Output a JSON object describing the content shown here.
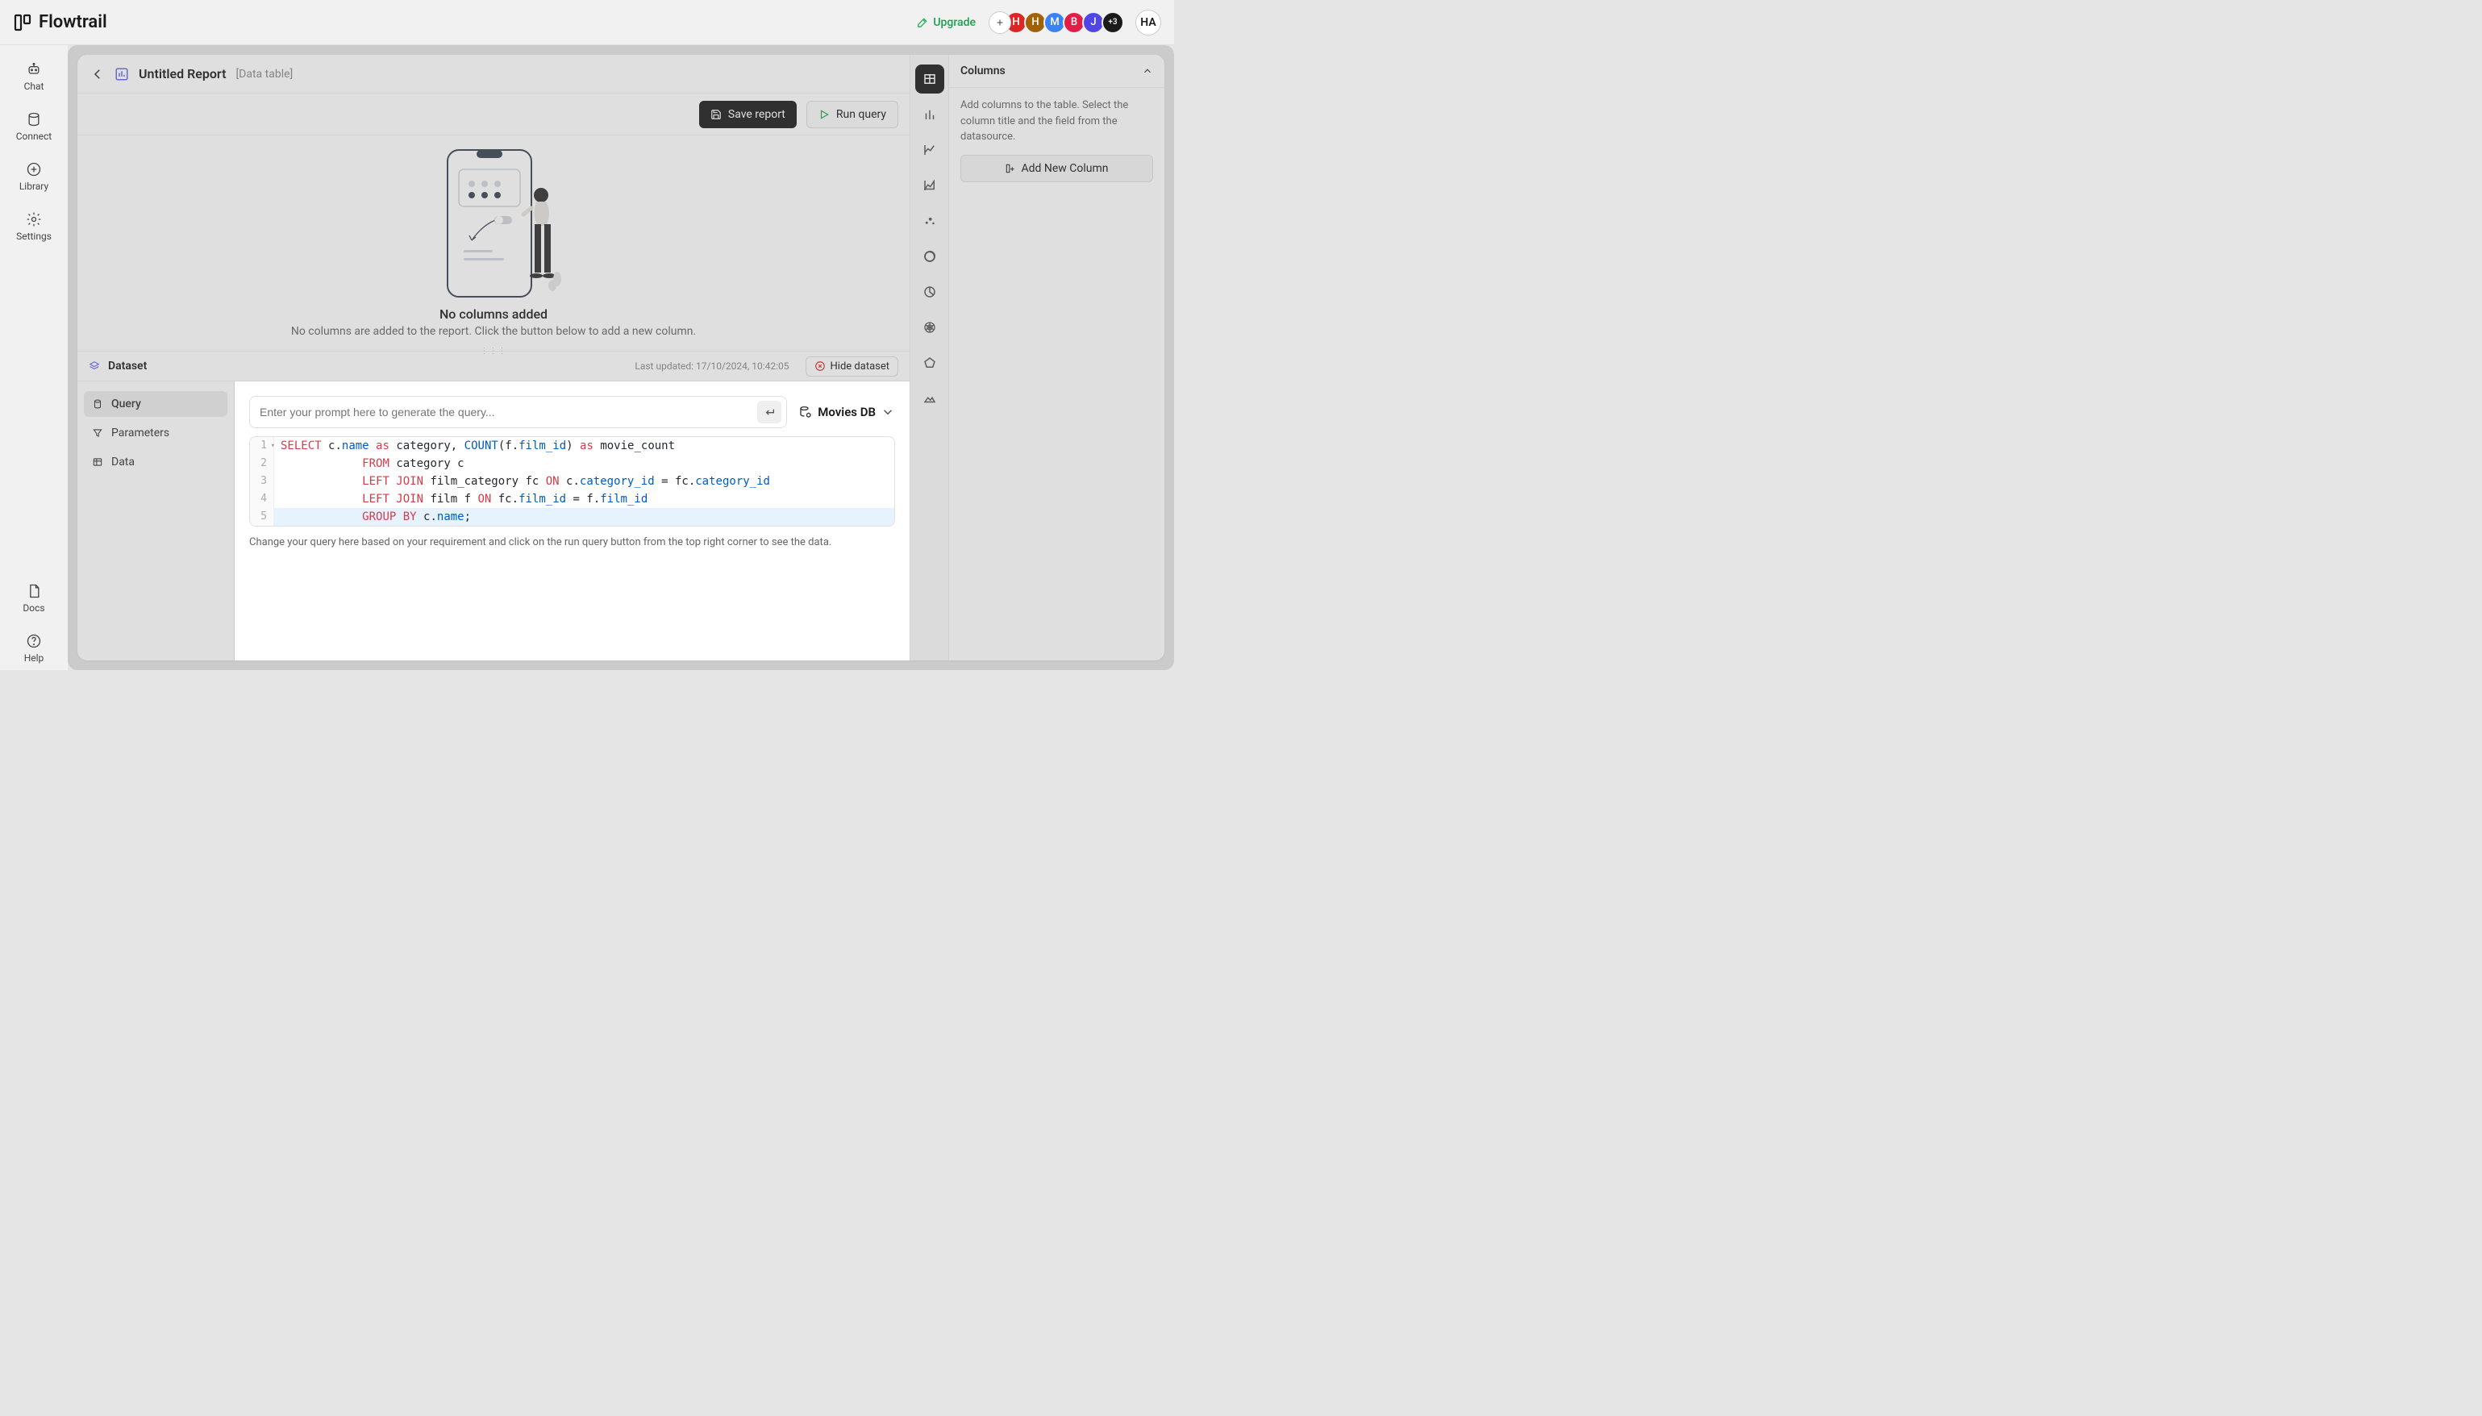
{
  "app": {
    "name": "Flowtrail"
  },
  "topbar": {
    "upgrade": "Upgrade",
    "avatars": [
      {
        "letter": "H",
        "bg": "#dc2626"
      },
      {
        "letter": "H",
        "bg": "#a16207"
      },
      {
        "letter": "M",
        "bg": "#3b82f6"
      },
      {
        "letter": "B",
        "bg": "#e11d48"
      },
      {
        "letter": "J",
        "bg": "#4f46e5"
      }
    ],
    "more_count": "+3",
    "me": "HA"
  },
  "leftnav": {
    "items": [
      {
        "id": "chat",
        "label": "Chat"
      },
      {
        "id": "connect",
        "label": "Connect"
      },
      {
        "id": "library",
        "label": "Library"
      },
      {
        "id": "settings",
        "label": "Settings"
      }
    ],
    "bottom": [
      {
        "id": "docs",
        "label": "Docs"
      },
      {
        "id": "help",
        "label": "Help"
      }
    ]
  },
  "report": {
    "title": "Untitled Report",
    "subtype": "[Data table]",
    "save_label": "Save report",
    "run_label": "Run query"
  },
  "empty": {
    "title": "No columns added",
    "sub": "No columns are added to the report. Click the button below to add a new column."
  },
  "dataset": {
    "title": "Dataset",
    "last_updated_label": "Last updated: 17/10/2024, 10:42:05",
    "hide_label": "Hide dataset",
    "tabs": {
      "query": "Query",
      "parameters": "Parameters",
      "data": "Data"
    }
  },
  "prompt": {
    "placeholder": "Enter your prompt here to generate the query...",
    "db_name": "Movies DB"
  },
  "sql": {
    "lines": [
      {
        "n": "1",
        "tokens": [
          {
            "t": "SELECT",
            "c": "kw-red"
          },
          {
            "t": " "
          },
          {
            "t": "c",
            "c": "plain"
          },
          {
            "t": ".",
            "c": "punct"
          },
          {
            "t": "name",
            "c": "kw-blue"
          },
          {
            "t": " "
          },
          {
            "t": "as",
            "c": "kw-red"
          },
          {
            "t": " "
          },
          {
            "t": "category",
            "c": "plain"
          },
          {
            "t": ",",
            "c": "punct"
          },
          {
            "t": " "
          },
          {
            "t": "COUNT",
            "c": "kw-blue"
          },
          {
            "t": "(",
            "c": "punct"
          },
          {
            "t": "f",
            "c": "plain"
          },
          {
            "t": ".",
            "c": "punct"
          },
          {
            "t": "film_id",
            "c": "kw-blue"
          },
          {
            "t": ")",
            "c": "punct"
          },
          {
            "t": " "
          },
          {
            "t": "as",
            "c": "kw-red"
          },
          {
            "t": " "
          },
          {
            "t": "movie_count",
            "c": "plain"
          }
        ]
      },
      {
        "n": "2",
        "tokens": [
          {
            "t": "            "
          },
          {
            "t": "FROM",
            "c": "kw-red"
          },
          {
            "t": " "
          },
          {
            "t": "category c",
            "c": "plain"
          }
        ]
      },
      {
        "n": "3",
        "tokens": [
          {
            "t": "            "
          },
          {
            "t": "LEFT JOIN",
            "c": "kw-red"
          },
          {
            "t": " "
          },
          {
            "t": "film_category fc ",
            "c": "plain"
          },
          {
            "t": "ON",
            "c": "kw-red"
          },
          {
            "t": " "
          },
          {
            "t": "c",
            "c": "plain"
          },
          {
            "t": ".",
            "c": "punct"
          },
          {
            "t": "category_id",
            "c": "kw-blue"
          },
          {
            "t": " ",
            "c": "plain"
          },
          {
            "t": "=",
            "c": "punct"
          },
          {
            "t": " fc",
            "c": "plain"
          },
          {
            "t": ".",
            "c": "punct"
          },
          {
            "t": "category_id",
            "c": "kw-blue"
          }
        ]
      },
      {
        "n": "4",
        "tokens": [
          {
            "t": "            "
          },
          {
            "t": "LEFT JOIN",
            "c": "kw-red"
          },
          {
            "t": " "
          },
          {
            "t": "film f ",
            "c": "plain"
          },
          {
            "t": "ON",
            "c": "kw-red"
          },
          {
            "t": " fc",
            "c": "plain"
          },
          {
            "t": ".",
            "c": "punct"
          },
          {
            "t": "film_id",
            "c": "kw-blue"
          },
          {
            "t": " ",
            "c": "plain"
          },
          {
            "t": "=",
            "c": "punct"
          },
          {
            "t": " f",
            "c": "plain"
          },
          {
            "t": ".",
            "c": "punct"
          },
          {
            "t": "film_id",
            "c": "kw-blue"
          }
        ]
      },
      {
        "n": "5",
        "hl": true,
        "tokens": [
          {
            "t": "            "
          },
          {
            "t": "GROUP BY",
            "c": "kw-red"
          },
          {
            "t": " c",
            "c": "plain"
          },
          {
            "t": ".",
            "c": "punct"
          },
          {
            "t": "name",
            "c": "kw-blue"
          },
          {
            "t": ";",
            "c": "punct"
          }
        ]
      }
    ]
  },
  "hint": "Change your query here based on your requirement and click on the run query button from the top right corner to see the data.",
  "views": [
    {
      "id": "table",
      "active": true
    },
    {
      "id": "bar"
    },
    {
      "id": "line"
    },
    {
      "id": "area"
    },
    {
      "id": "scatter"
    },
    {
      "id": "donut"
    },
    {
      "id": "pie"
    },
    {
      "id": "radar"
    },
    {
      "id": "pentagon"
    },
    {
      "id": "image"
    }
  ],
  "right": {
    "header": "Columns",
    "desc": "Add columns to the table. Select the column title and the field from the datasource.",
    "add_label": "Add New Column"
  }
}
